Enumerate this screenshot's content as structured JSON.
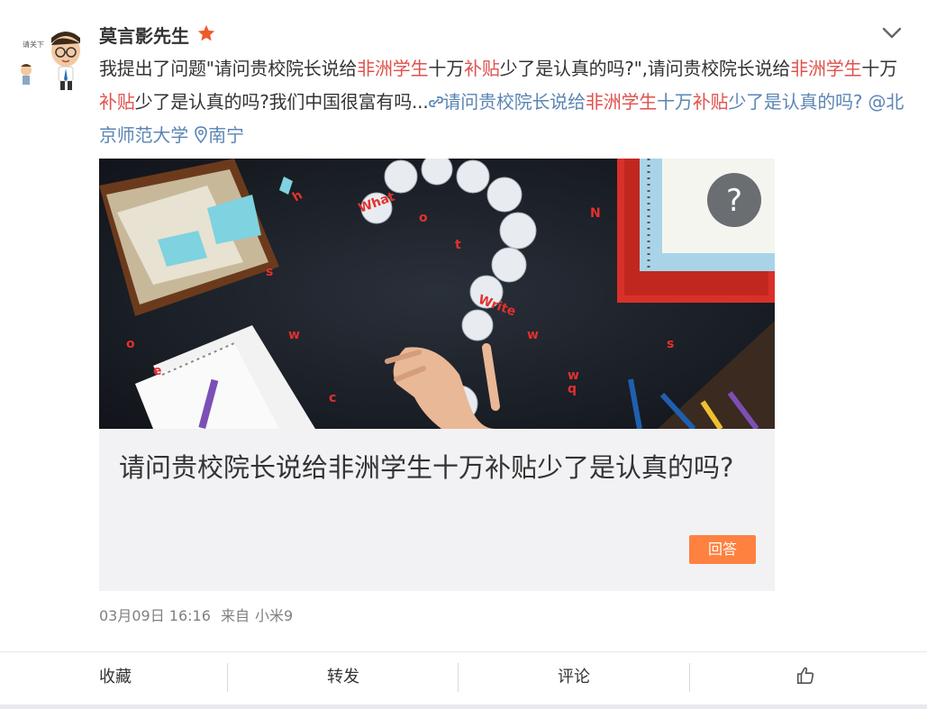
{
  "post": {
    "username": "莫言影先生",
    "text": {
      "intro": "我提出了问题\"请问贵校院长说给",
      "hl1": "非洲学生",
      "mid1": "十万",
      "hl2": "补贴",
      "mid2": "少了是认真的吗?\",请问贵校院长说给",
      "hl3": "非洲学生",
      "mid3": "十万",
      "hl4": "补贴",
      "mid4": "少了是认真的吗?我们中国很富有吗...",
      "link_a": "请问贵校院长说给",
      "link_hl1": "非洲学生",
      "link_b": "十万",
      "link_hl2": "补贴",
      "link_c": "少了是认真的吗?",
      "mention": "@北京师范大学",
      "location": "南宁"
    },
    "card": {
      "title": "请问贵校院长说给非洲学生十万补贴少了是认真的吗?",
      "answer_label": "回答"
    },
    "meta": {
      "date": "03月09日 16:16",
      "source_prefix": "来自",
      "source": "小米9"
    }
  },
  "actions": {
    "favorite": "收藏",
    "repost": "转发",
    "comment": "评论"
  },
  "colors": {
    "highlight": "#e0514c",
    "link": "#5b85b4",
    "button": "#ff8140"
  },
  "icons": [
    "star-badge-icon",
    "chevron-down-icon",
    "link-icon",
    "location-pin-icon",
    "question-mark-icon",
    "like-icon"
  ]
}
